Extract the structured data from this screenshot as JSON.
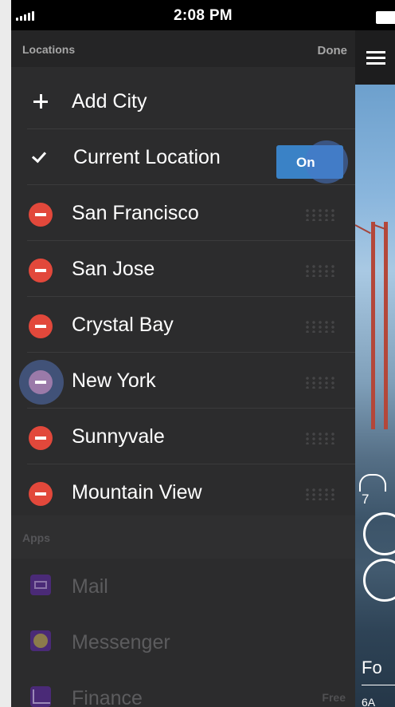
{
  "status_bar": {
    "time": "2:08 PM"
  },
  "locations": {
    "header": "Locations",
    "done_label": "Done",
    "add_city_label": "Add City",
    "current_location": {
      "label": "Current Location",
      "toggle_label": "On",
      "toggle_on": true
    },
    "cities": [
      {
        "name": "San Francisco"
      },
      {
        "name": "San Jose"
      },
      {
        "name": "Crystal Bay"
      },
      {
        "name": "New York"
      },
      {
        "name": "Sunnyvale"
      },
      {
        "name": "Mountain View"
      }
    ]
  },
  "apps": {
    "header": "Apps",
    "items": [
      {
        "label": "Mail",
        "icon": "mail-icon"
      },
      {
        "label": "Messenger",
        "icon": "messenger-icon"
      },
      {
        "label": "Finance",
        "icon": "finance-icon",
        "badge": "Free"
      }
    ]
  },
  "colors": {
    "delete_red": "#e2483b",
    "toggle_blue": "#3a82c6",
    "drawer_bg": "#2c2c2d"
  }
}
